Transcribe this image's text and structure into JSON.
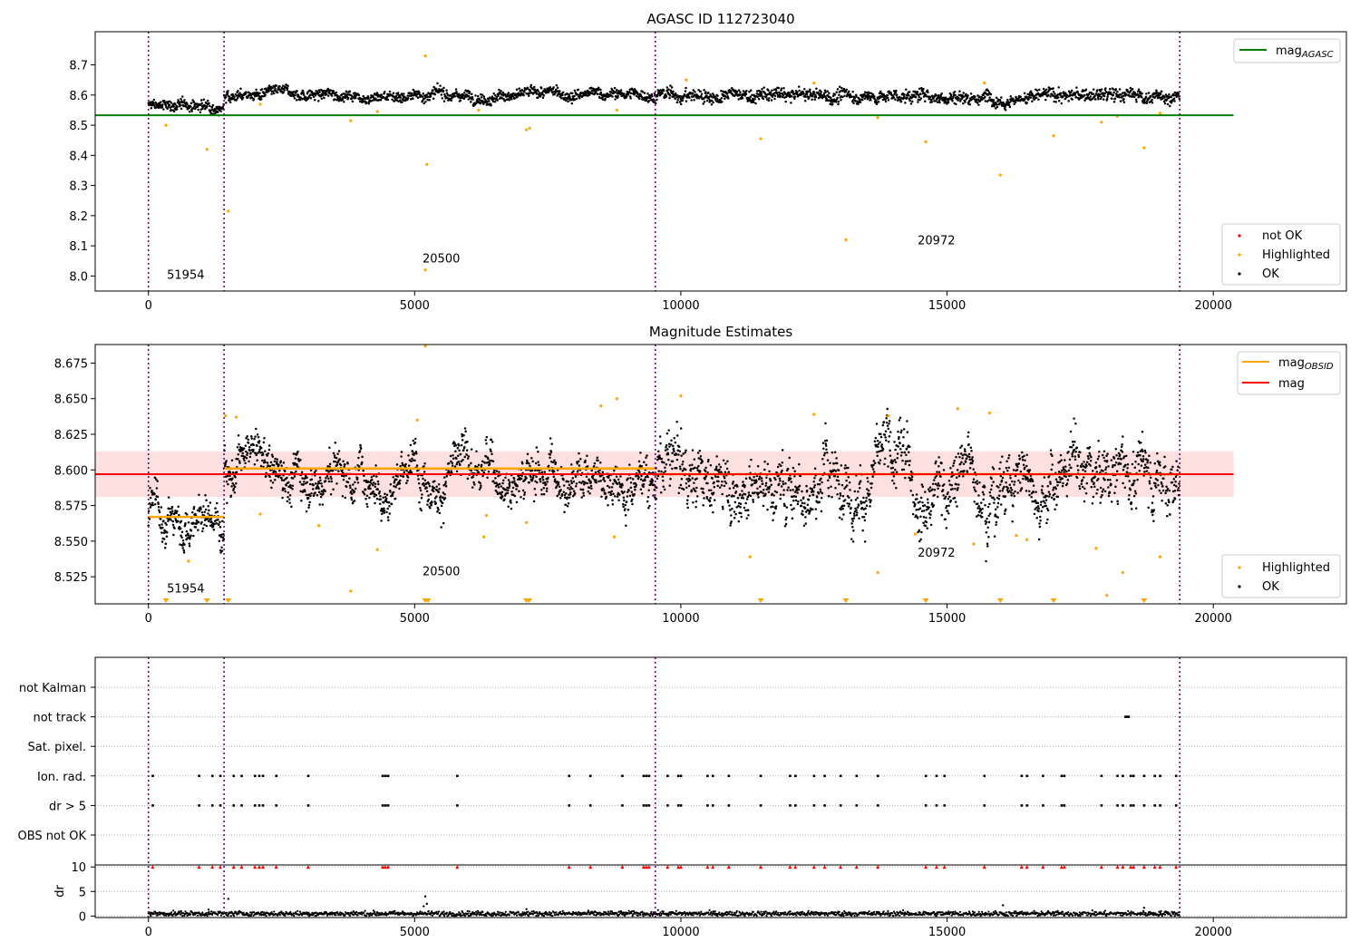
{
  "colors": {
    "ok": "#000000",
    "highlighted": "#ffa500",
    "not_ok": "#ff0000",
    "agasc_line": "#008000",
    "mag_line": "#ff0000",
    "obsid_line": "#ffa500",
    "obsid_boundary": "#800080",
    "band": "#ffcccc",
    "grid": "#b0b0b0"
  },
  "chart_data": [
    {
      "type": "scatter",
      "title": "AGASC ID 112723040",
      "xlim": [
        -1000,
        22500
      ],
      "ylim": [
        7.95,
        8.81
      ],
      "x_ticks": [
        0,
        5000,
        10000,
        15000,
        20000
      ],
      "x_tick_labels": [
        "0",
        "5000",
        "10000",
        "15000",
        "20000"
      ],
      "y_ticks": [
        8.0,
        8.1,
        8.2,
        8.3,
        8.4,
        8.5,
        8.6,
        8.7
      ],
      "y_tick_labels": [
        "8.0",
        "8.1",
        "8.2",
        "8.3",
        "8.4",
        "8.5",
        "8.6",
        "8.7"
      ],
      "obsid_boundaries": [
        0,
        1420,
        9520,
        19370
      ],
      "obsid_labels": [
        {
          "text": "51954",
          "x": 700,
          "y": 7.99
        },
        {
          "text": "20500",
          "x": 5500,
          "y": 8.045
        },
        {
          "text": "20972",
          "x": 14800,
          "y": 8.105
        }
      ],
      "mag_agasc": {
        "value": 8.533,
        "x_range": [
          -1000,
          20380
        ]
      },
      "ok_segments": [
        {
          "x": [
            0,
            1420
          ],
          "center": 8.565,
          "spread": 0.012
        },
        {
          "x": [
            1420,
            9520
          ],
          "center": 8.601,
          "spread": 0.012
        },
        {
          "x": [
            9520,
            19370
          ],
          "center": 8.597,
          "spread": 0.014
        }
      ],
      "highlighted_points": [
        [
          330,
          8.5
        ],
        [
          1100,
          8.42
        ],
        [
          1500,
          8.215
        ],
        [
          5200,
          8.73
        ],
        [
          5230,
          8.37
        ],
        [
          5200,
          8.02
        ],
        [
          3800,
          8.515
        ],
        [
          7100,
          8.485
        ],
        [
          7160,
          8.49
        ],
        [
          8800,
          8.55
        ],
        [
          11500,
          8.455
        ],
        [
          13100,
          8.12
        ],
        [
          13700,
          8.525
        ],
        [
          14600,
          8.445
        ],
        [
          16000,
          8.335
        ],
        [
          17000,
          8.465
        ],
        [
          17900,
          8.51
        ],
        [
          18700,
          8.425
        ],
        [
          2100,
          8.57
        ],
        [
          4300,
          8.545
        ],
        [
          6200,
          8.55
        ],
        [
          10100,
          8.65
        ],
        [
          12500,
          8.64
        ],
        [
          15700,
          8.64
        ],
        [
          18200,
          8.53
        ],
        [
          19000,
          8.54
        ]
      ],
      "legend_top": [
        {
          "label": "mag",
          "subscript": "AGASC",
          "marker": "line",
          "color": "#008000"
        }
      ],
      "legend_bottom": [
        {
          "label": "not OK",
          "marker": "dot",
          "color": "#ff0000"
        },
        {
          "label": "Highlighted",
          "marker": "dot",
          "color": "#ffa500"
        },
        {
          "label": "OK",
          "marker": "dot",
          "color": "#000000"
        }
      ],
      "legend_placement": "top-right and bottom-right"
    },
    {
      "type": "scatter",
      "title": "Magnitude Estimates",
      "xlim": [
        -1000,
        22500
      ],
      "ylim": [
        8.506,
        8.688
      ],
      "x_ticks": [
        0,
        5000,
        10000,
        15000,
        20000
      ],
      "x_tick_labels": [
        "0",
        "5000",
        "10000",
        "15000",
        "20000"
      ],
      "y_ticks": [
        8.525,
        8.55,
        8.575,
        8.6,
        8.625,
        8.65,
        8.675
      ],
      "y_tick_labels": [
        "8.525",
        "8.550",
        "8.575",
        "8.600",
        "8.625",
        "8.650",
        "8.675"
      ],
      "obsid_boundaries": [
        0,
        1420,
        9520,
        19370
      ],
      "obsid_labels": [
        {
          "text": "51954",
          "x": 700,
          "y": 8.514
        },
        {
          "text": "20500",
          "x": 5500,
          "y": 8.526
        },
        {
          "text": "20972",
          "x": 14800,
          "y": 8.539
        }
      ],
      "mag": {
        "value": 8.597,
        "band": [
          8.581,
          8.613
        ],
        "x_range": [
          -1000,
          20380
        ]
      },
      "mag_obsid": [
        {
          "x": [
            0,
            1420
          ],
          "value": 8.567
        },
        {
          "x": [
            1420,
            9520
          ],
          "value": 8.601
        },
        {
          "x": [
            9520,
            19370
          ],
          "value": 8.597
        }
      ],
      "ok_segments": [
        {
          "x": [
            0,
            1420
          ],
          "center": 8.566,
          "spread": 0.0075
        },
        {
          "x": [
            1420,
            9520
          ],
          "center": 8.601,
          "spread": 0.0085
        },
        {
          "x": [
            9520,
            19370
          ],
          "center": 8.597,
          "spread": 0.011
        }
      ],
      "highlighted_points": [
        [
          5200,
          8.687
        ],
        [
          750,
          8.536
        ],
        [
          2100,
          8.569
        ],
        [
          3200,
          8.561
        ],
        [
          3800,
          8.515
        ],
        [
          4300,
          8.544
        ],
        [
          5050,
          8.635
        ],
        [
          6300,
          8.553
        ],
        [
          6350,
          8.568
        ],
        [
          7100,
          8.563
        ],
        [
          8500,
          8.645
        ],
        [
          8750,
          8.553
        ],
        [
          8800,
          8.65
        ],
        [
          10000,
          8.652
        ],
        [
          11300,
          8.539
        ],
        [
          12500,
          8.639
        ],
        [
          13700,
          8.528
        ],
        [
          13900,
          8.638
        ],
        [
          14400,
          8.555
        ],
        [
          15200,
          8.643
        ],
        [
          15500,
          8.548
        ],
        [
          15800,
          8.64
        ],
        [
          16300,
          8.554
        ],
        [
          16500,
          8.551
        ],
        [
          17800,
          8.545
        ],
        [
          18000,
          8.512
        ],
        [
          18300,
          8.528
        ],
        [
          19000,
          8.539
        ],
        [
          1450,
          8.638
        ],
        [
          1650,
          8.637
        ]
      ],
      "below_range_markers": [
        330,
        1100,
        1500,
        5200,
        5250,
        7100,
        7150,
        11500,
        13100,
        14600,
        16000,
        17000,
        18700
      ],
      "legend_top": [
        {
          "label": "mag",
          "subscript": "OBSID",
          "marker": "line",
          "color": "#ffa500"
        },
        {
          "label": "mag",
          "subscript": "",
          "marker": "line",
          "color": "#ff0000"
        }
      ],
      "legend_bottom": [
        {
          "label": "Highlighted",
          "marker": "dot",
          "color": "#ffa500"
        },
        {
          "label": "OK",
          "marker": "dot",
          "color": "#000000"
        }
      ],
      "legend_placement": "top-right and bottom-right"
    },
    {
      "type": "scatter",
      "title": "",
      "xlim": [
        -1000,
        22500
      ],
      "x_ticks": [
        0,
        5000,
        10000,
        15000,
        20000
      ],
      "x_tick_labels": [
        "0",
        "5000",
        "10000",
        "15000",
        "20000"
      ],
      "obsid_boundaries": [
        0,
        1420,
        9520,
        19370
      ],
      "flag_rows": [
        "not Kalman",
        "not track",
        "Sat. pixel.",
        "Ion. rad.",
        "dr > 5",
        "OBS not OK"
      ],
      "flag_events": {
        "not Kalman": [],
        "not track": [
          18350,
          18380,
          18410
        ],
        "Sat. pixel.": [],
        "Ion. rad.": [
          80,
          950,
          1200,
          1350,
          1600,
          1750,
          2000,
          2080,
          2150,
          2400,
          3000,
          4400,
          4450,
          4500,
          5800,
          7900,
          8300,
          8900,
          9300,
          9350,
          9400,
          9750,
          9950,
          10000,
          10500,
          10600,
          10900,
          11500,
          12050,
          12150,
          12500,
          12700,
          13000,
          13300,
          13700,
          14600,
          14800,
          14950,
          15700,
          16400,
          16500,
          16800,
          17150,
          17200,
          17900,
          18200,
          18300,
          18450,
          18500,
          18700,
          18900,
          19000,
          19300
        ],
        "dr > 5": [
          80,
          950,
          1200,
          1350,
          1600,
          1750,
          2000,
          2080,
          2150,
          2400,
          3000,
          4400,
          4450,
          4500,
          5800,
          7900,
          8300,
          8900,
          9300,
          9350,
          9400,
          9750,
          9950,
          10000,
          10500,
          10600,
          10900,
          11500,
          12050,
          12150,
          12500,
          12700,
          13000,
          13300,
          13700,
          14600,
          14800,
          14950,
          15700,
          16400,
          16500,
          16800,
          17150,
          17200,
          17900,
          18200,
          18300,
          18450,
          18500,
          18700,
          18900,
          19000,
          19300
        ],
        "OBS not OK": []
      },
      "dr": {
        "ylabel": "dr",
        "ylim": [
          -0.3,
          10.4
        ],
        "y_ticks": [
          0,
          5,
          10
        ],
        "y_tick_labels": [
          "0",
          "5",
          "10"
        ],
        "typical": 0.5,
        "outliers": [
          [
            5200,
            4.0
          ],
          [
            5230,
            2.5
          ],
          [
            5170,
            2.0
          ],
          [
            16050,
            2.2
          ],
          [
            18700,
            1.7
          ],
          [
            1500,
            3.5
          ],
          [
            1130,
            1.3
          ],
          [
            7100,
            1.4
          ]
        ],
        "clipped_markers_at": 10,
        "clipped_x": [
          80,
          950,
          1200,
          1350,
          1600,
          1750,
          2000,
          2080,
          2150,
          2400,
          3000,
          4400,
          4450,
          4500,
          5800,
          7900,
          8300,
          8900,
          9300,
          9350,
          9400,
          9750,
          9950,
          10000,
          10500,
          10600,
          10900,
          11500,
          12050,
          12150,
          12500,
          12700,
          13000,
          13300,
          13700,
          14600,
          14800,
          14950,
          15700,
          16400,
          16500,
          16800,
          17150,
          17200,
          17900,
          18200,
          18300,
          18450,
          18500,
          18700,
          18900,
          19000,
          19300
        ]
      }
    }
  ]
}
